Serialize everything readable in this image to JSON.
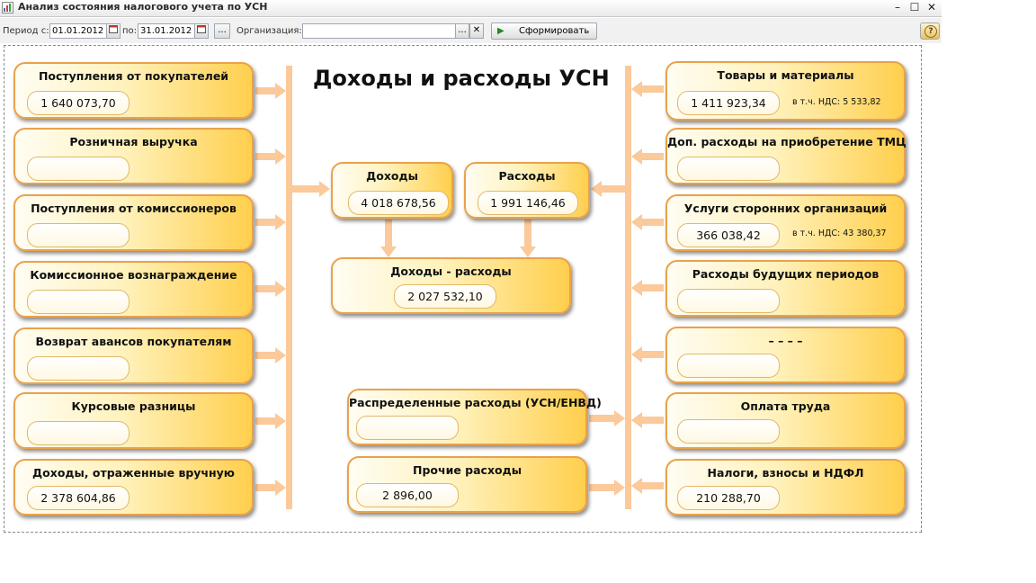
{
  "window": {
    "title": "Анализ состояния налогового учета по УСН",
    "controls": {
      "minimize": "–",
      "maximize": "☐",
      "close": "✕"
    }
  },
  "toolbar": {
    "period_from_label": "Период с:",
    "period_from_value": "01.01.2012",
    "period_to_label": "по:",
    "period_to_value": "31.01.2012",
    "period_select_label": "...",
    "org_label": "Организация:",
    "org_value": "",
    "org_select_label": "...",
    "org_clear_label": "✕",
    "generate_label": "Сформировать",
    "help_label": "?"
  },
  "diagram": {
    "title": "Доходы и расходы УСН",
    "income_sources": [
      {
        "label": "Поступления от покупателей",
        "value": "1 640 073,70"
      },
      {
        "label": "Розничная выручка",
        "value": ""
      },
      {
        "label": "Поступления от комиссионеров",
        "value": ""
      },
      {
        "label": "Комиссионное вознаграждение",
        "value": ""
      },
      {
        "label": "Возврат авансов покупателям",
        "value": ""
      },
      {
        "label": "Курсовые разницы",
        "value": ""
      },
      {
        "label": "Доходы, отраженные вручную",
        "value": "2 378 604,86"
      }
    ],
    "summary": {
      "income": {
        "label": "Доходы",
        "value": "4 018 678,56"
      },
      "expenses": {
        "label": "Расходы",
        "value": "1 991 146,46"
      },
      "difference": {
        "label": "Доходы - расходы",
        "value": "2 027 532,10"
      },
      "distributed": {
        "label": "Распределенные расходы (УСН/ЕНВД)",
        "value": ""
      },
      "other": {
        "label": "Прочие расходы",
        "value": "2 896,00"
      }
    },
    "expense_sources": [
      {
        "label": "Товары и материалы",
        "value": "1 411 923,34",
        "vat": "в т.ч. НДС: 5 533,82"
      },
      {
        "label": "Доп. расходы на приобретение ТМЦ",
        "value": "",
        "vat": ""
      },
      {
        "label": "Услуги сторонних организаций",
        "value": "366 038,42",
        "vat": "в т.ч. НДС: 43 380,37"
      },
      {
        "label": "Расходы будущих периодов",
        "value": "",
        "vat": ""
      },
      {
        "label": "– – – –",
        "value": "",
        "vat": ""
      },
      {
        "label": "Оплата труда",
        "value": "",
        "vat": ""
      },
      {
        "label": "Налоги, взносы и НДФЛ",
        "value": "210 288,70",
        "vat": ""
      }
    ],
    "colors": {
      "box_border": "#e9a24a",
      "box_fill_light": "#fffdf3",
      "box_fill_dark": "#ffcf4d",
      "arrow": "#fbc99a"
    }
  }
}
